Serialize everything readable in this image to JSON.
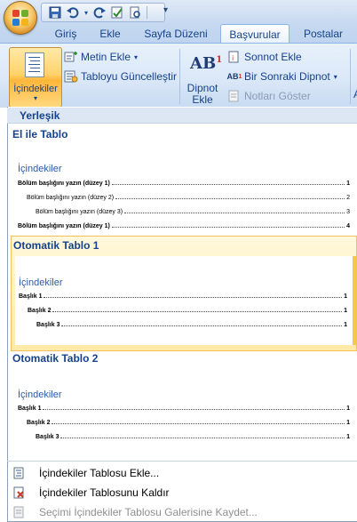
{
  "quick_access": {
    "save_icon": "save-icon",
    "undo_icon": "undo-icon",
    "redo_icon": "redo-icon",
    "spelling_icon": "spelling-icon",
    "print_icon": "print-preview-icon",
    "customize_icon": "chevron-down-icon"
  },
  "tabs": [
    {
      "label": "Giriş"
    },
    {
      "label": "Ekle"
    },
    {
      "label": "Sayfa Düzeni"
    },
    {
      "label": "Başvurular",
      "active": true
    },
    {
      "label": "Postalar"
    }
  ],
  "ribbon": {
    "toc_button": "İçindekiler",
    "add_text": "Metin Ekle",
    "update_table": "Tabloyu Güncelleştir",
    "insert_footnote_line1": "Dipnot",
    "insert_footnote_line2": "Ekle",
    "insert_endnote": "Sonnot Ekle",
    "next_footnote": "Bir Sonraki Dipnot",
    "show_notes": "Notları Göster",
    "cut_letter": "A"
  },
  "gallery": {
    "category": "Yerleşik",
    "items": [
      {
        "title": "El ile Tablo",
        "heading": "İçindekiler",
        "lines": [
          {
            "text": "Bölüm başlığını yazın (düzey 1)",
            "num": "1"
          },
          {
            "text": "Bölüm başlığını yazın (düzey 2)",
            "num": "2"
          },
          {
            "text": "Bölüm başlığını yazın (düzey 3)",
            "num": "3"
          },
          {
            "text": "Bölüm başlığını yazın (düzey 1)",
            "num": "4"
          }
        ]
      },
      {
        "title": "Otomatik Tablo 1",
        "heading": "İçindekiler",
        "lines": [
          {
            "text": "Başlık 1",
            "num": "1"
          },
          {
            "text": "Başlık 2",
            "num": "1"
          },
          {
            "text": "Başlık 3",
            "num": "1"
          }
        ]
      },
      {
        "title": "Otomatik Tablo 2",
        "heading": "İçindekiler",
        "lines": [
          {
            "text": "Başlık 1",
            "num": "1"
          },
          {
            "text": "Başlık 2",
            "num": "1"
          },
          {
            "text": "Başlık 3",
            "num": "1"
          }
        ]
      }
    ]
  },
  "menu": {
    "insert_toc": "İçindekiler Tablosu Ekle...",
    "remove_toc": "İçindekiler Tablosunu Kaldır",
    "save_selection": "Seçimi İçindekiler Tablosu Galerisine Kaydet..."
  },
  "colors": {
    "accent": "#15428b",
    "selection": "#ffe9a8",
    "heading_blue": "#2a5caa"
  }
}
